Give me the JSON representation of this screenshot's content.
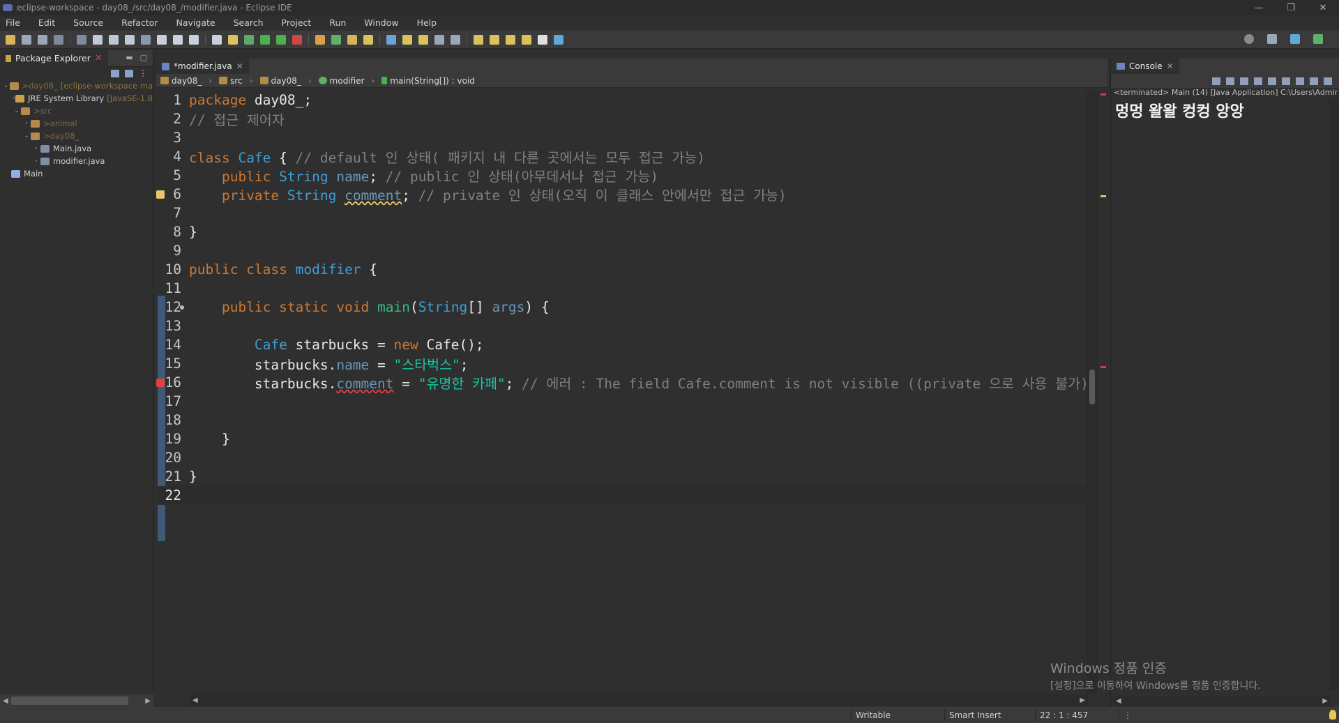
{
  "window": {
    "title": "eclipse-workspace - day08_/src/day08_/modifier.java - Eclipse IDE",
    "controls": [
      "—",
      "❐",
      "✕"
    ]
  },
  "menu": [
    "File",
    "Edit",
    "Source",
    "Refactor",
    "Navigate",
    "Search",
    "Project",
    "Run",
    "Window",
    "Help"
  ],
  "package_explorer": {
    "tab_label": "Package Explorer",
    "tree": [
      {
        "prefix": "> ",
        "label": "day08_",
        "decoration": "[eclipse-workspace ma",
        "icon": "project-icon",
        "icon_color": "#b48a4a",
        "depth": 0,
        "arrow": "v"
      },
      {
        "prefix": "",
        "label": "JRE System Library",
        "decoration": "[JavaSE-1.8",
        "icon": "library-icon",
        "icon_color": "#c9a24a",
        "depth": 1,
        "arrow": ">"
      },
      {
        "prefix": "> ",
        "label": "src",
        "decoration": "",
        "icon": "source-folder-icon",
        "icon_color": "#b48a4a",
        "depth": 1,
        "arrow": "v"
      },
      {
        "prefix": "> ",
        "label": "animal",
        "decoration": "",
        "icon": "package-icon",
        "icon_color": "#b48a4a",
        "depth": 2,
        "arrow": ">"
      },
      {
        "prefix": "> ",
        "label": "day08_",
        "decoration": "",
        "icon": "package-icon",
        "icon_color": "#b48a4a",
        "depth": 2,
        "arrow": "v"
      },
      {
        "prefix": "",
        "label": "Main.java",
        "decoration": "",
        "icon": "java-file-icon",
        "icon_color": "#7f8fa8",
        "depth": 3,
        "arrow": ">"
      },
      {
        "prefix": "",
        "label": "modifier.java",
        "decoration": "",
        "icon": "java-file-icon",
        "icon_color": "#7f8fa8",
        "depth": 3,
        "arrow": ">"
      },
      {
        "prefix": "",
        "label": "Main",
        "decoration": "",
        "icon": "folder-icon",
        "icon_color": "#8fb0e0",
        "depth": 0,
        "arrow": ""
      }
    ]
  },
  "editor": {
    "tab_label": "*modifier.java",
    "breadcrumb": [
      "day08_",
      "src",
      "day08_",
      "modifier",
      "main(String[]) : void"
    ],
    "lines": [
      {
        "n": "1",
        "t": [
          [
            "kw",
            "package "
          ],
          [
            "pl",
            "day08_;"
          ]
        ]
      },
      {
        "n": "2",
        "t": [
          [
            "cm",
            "// 접근 제어자"
          ]
        ]
      },
      {
        "n": "3",
        "t": []
      },
      {
        "n": "4",
        "t": [
          [
            "kw",
            "class "
          ],
          [
            "ty",
            "Cafe"
          ],
          [
            "pl",
            " { "
          ],
          [
            "cm",
            "// default 인 상태( 패키지 내 다른 곳에서는 모두 접근 가능)"
          ]
        ]
      },
      {
        "n": "5",
        "t": [
          [
            "pl",
            "    "
          ],
          [
            "kw",
            "public "
          ],
          [
            "ty",
            "String "
          ],
          [
            "fd",
            "name"
          ],
          [
            "pl",
            "; "
          ],
          [
            "cm",
            "// public 인 상태(아무데서나 접근 가능)"
          ]
        ]
      },
      {
        "n": "6",
        "t": [
          [
            "pl",
            "    "
          ],
          [
            "kw",
            "private "
          ],
          [
            "ty",
            "String "
          ],
          [
            "fd wv",
            "comment"
          ],
          [
            "pl",
            "; "
          ],
          [
            "cm",
            "// private 인 상태(오직 이 클래스 안에서만 접근 가능)"
          ]
        ]
      },
      {
        "n": "7",
        "t": []
      },
      {
        "n": "8",
        "t": [
          [
            "pl",
            "}"
          ]
        ]
      },
      {
        "n": "9",
        "t": []
      },
      {
        "n": "10",
        "t": [
          [
            "kw",
            "public class "
          ],
          [
            "ty",
            "modifier"
          ],
          [
            "pl",
            " {"
          ]
        ]
      },
      {
        "n": "11",
        "t": []
      },
      {
        "n": "12",
        "t": [
          [
            "pl",
            "    "
          ],
          [
            "kw",
            "public static void "
          ],
          [
            "fn",
            "main"
          ],
          [
            "pl",
            "("
          ],
          [
            "ty",
            "String"
          ],
          [
            "pl",
            "[] "
          ],
          [
            "fd",
            "args"
          ],
          [
            "pl",
            ") {"
          ]
        ]
      },
      {
        "n": "13",
        "t": []
      },
      {
        "n": "14",
        "t": [
          [
            "pl",
            "        "
          ],
          [
            "ty",
            "Cafe "
          ],
          [
            "pl",
            "starbucks = "
          ],
          [
            "kw",
            "new "
          ],
          [
            "pl",
            "Cafe();"
          ]
        ]
      },
      {
        "n": "15",
        "t": [
          [
            "pl",
            "        starbucks."
          ],
          [
            "fd",
            "name"
          ],
          [
            "pl",
            " = "
          ],
          [
            "st",
            "\"스타벅스\""
          ],
          [
            "pl",
            ";"
          ]
        ]
      },
      {
        "n": "16",
        "t": [
          [
            "pl",
            "        starbucks."
          ],
          [
            "fd wr",
            "comment"
          ],
          [
            "pl",
            " = "
          ],
          [
            "st",
            "\"유명한 카페\""
          ],
          [
            "pl",
            "; "
          ],
          [
            "cm",
            "// 에러 : The field Cafe.comment is not visible ((private 으로 사용 불가)"
          ]
        ]
      },
      {
        "n": "17",
        "t": []
      },
      {
        "n": "18",
        "t": []
      },
      {
        "n": "19",
        "t": [
          [
            "pl",
            "    }"
          ]
        ]
      },
      {
        "n": "20",
        "t": []
      },
      {
        "n": "21",
        "t": [
          [
            "pl",
            "}"
          ]
        ]
      },
      {
        "n": "22",
        "t": []
      }
    ]
  },
  "console": {
    "tab_label": "Console",
    "status": "<terminated> Main (14) [Java Application] C:\\Users\\Admir",
    "output": "멍멍 왈왈 컹컹 앙앙"
  },
  "watermark": {
    "line1": "Windows 정품 인증",
    "line2": "[설정]으로 이동하여 Windows를 정품 인증합니다."
  },
  "status_bar": {
    "mode": "Writable",
    "insert": "Smart Insert",
    "position": "22 : 1 : 457"
  },
  "colors": {
    "keyword": "#cc7832",
    "type": "#3aa0d8",
    "field": "#6897bb",
    "method": "#2cc080",
    "string": "#17c6a3",
    "comment": "#808080",
    "error": "#e04040",
    "warning": "#e8c46a"
  }
}
